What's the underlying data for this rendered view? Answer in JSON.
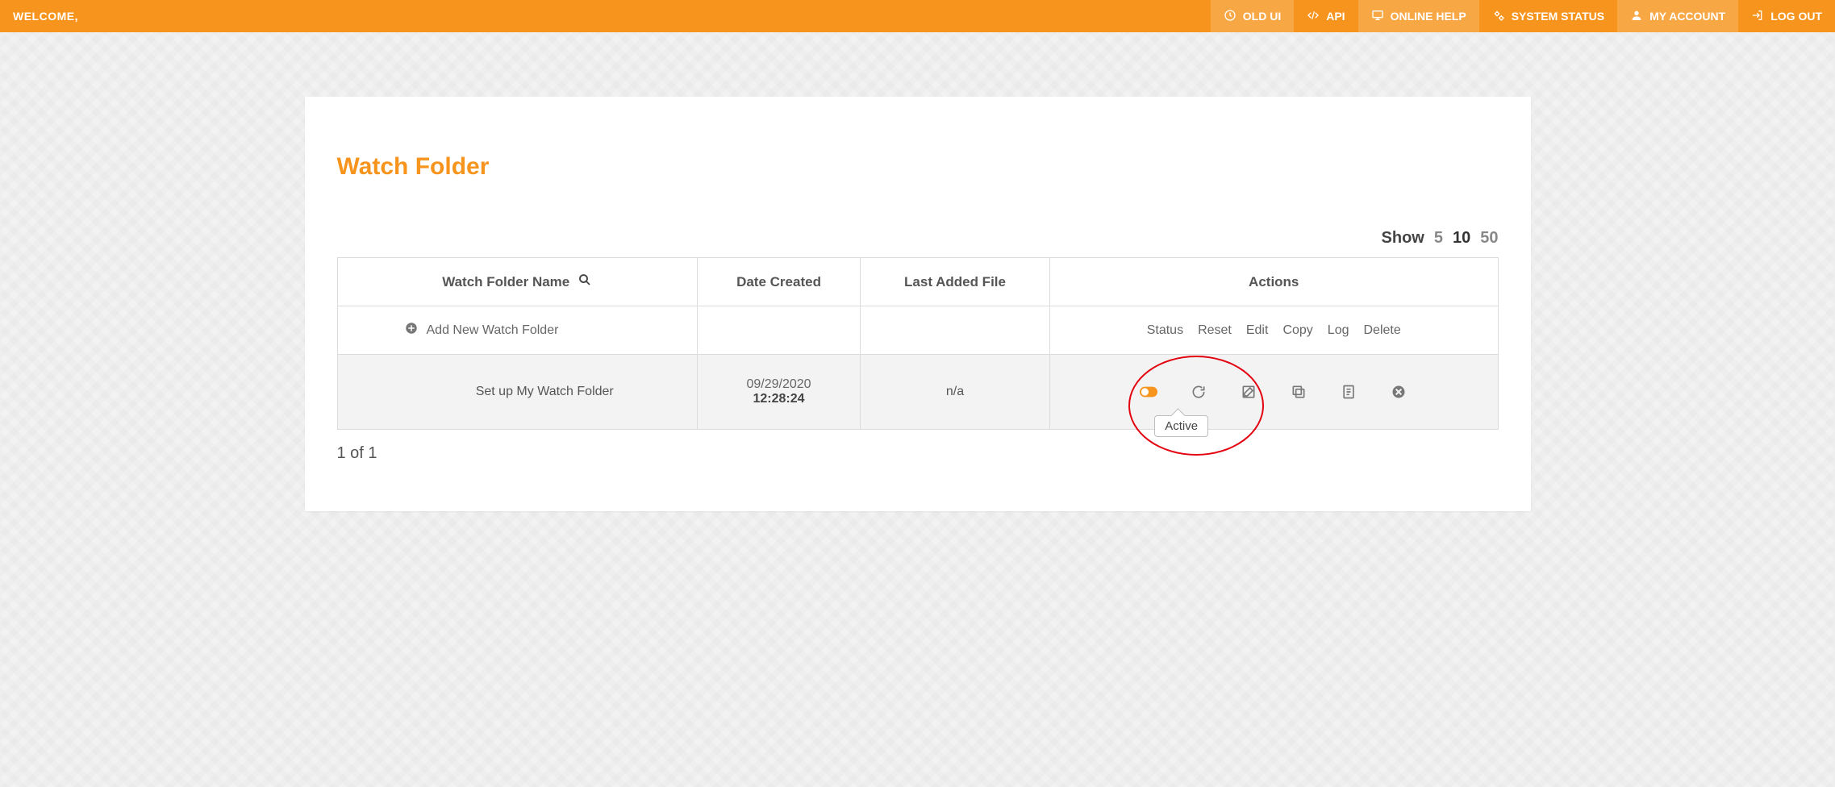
{
  "header": {
    "welcome": "WELCOME,",
    "nav": {
      "old_ui": "OLD UI",
      "api": "API",
      "online_help": "ONLINE HELP",
      "system_status": "SYSTEM STATUS",
      "my_account": "MY ACCOUNT",
      "log_out": "LOG OUT"
    }
  },
  "page": {
    "title": "Watch Folder",
    "show_label": "Show",
    "show_options": {
      "a": "5",
      "b": "10",
      "c": "50"
    },
    "columns": {
      "name": "Watch Folder Name",
      "date": "Date Created",
      "last": "Last Added File",
      "actions": "Actions"
    },
    "add_label": "Add New Watch Folder",
    "action_headers": {
      "status": "Status",
      "reset": "Reset",
      "edit": "Edit",
      "copy": "Copy",
      "log": "Log",
      "delete": "Delete"
    },
    "row": {
      "name": "Set up My Watch Folder",
      "date": "09/29/2020",
      "time": "12:28:24",
      "last": "n/a",
      "tooltip": "Active"
    },
    "pager": "1 of 1"
  }
}
